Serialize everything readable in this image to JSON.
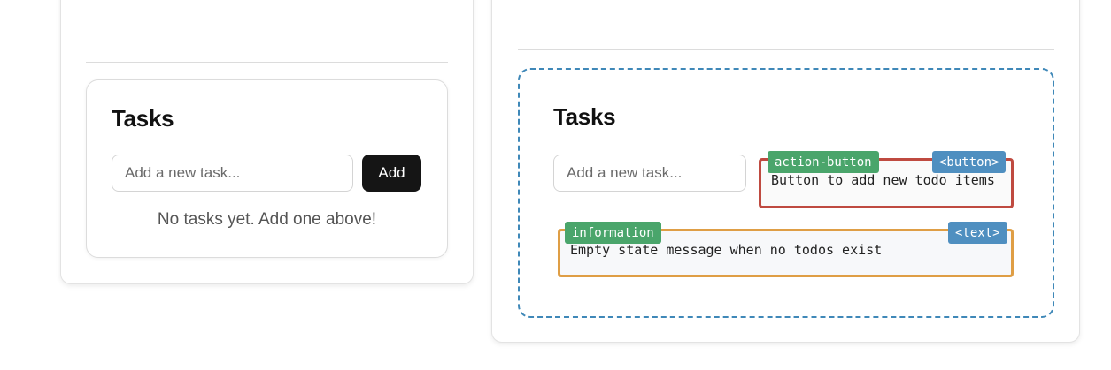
{
  "left": {
    "title": "Tasks",
    "input_placeholder": "Add a new task...",
    "add_label": "Add",
    "empty_message": "No tasks yet. Add one above!"
  },
  "right": {
    "title": "Tasks",
    "input_placeholder": "Add a new task...",
    "annotations": {
      "button": {
        "category": "action-button",
        "element_type": "<button>",
        "description": "Button to add new todo items",
        "color": "#bf4a40"
      },
      "text": {
        "category": "information",
        "element_type": "<text>",
        "description": "Empty state message when no todos exist",
        "color": "#df9e45"
      }
    },
    "container_outline_color": "#3f88b8"
  }
}
